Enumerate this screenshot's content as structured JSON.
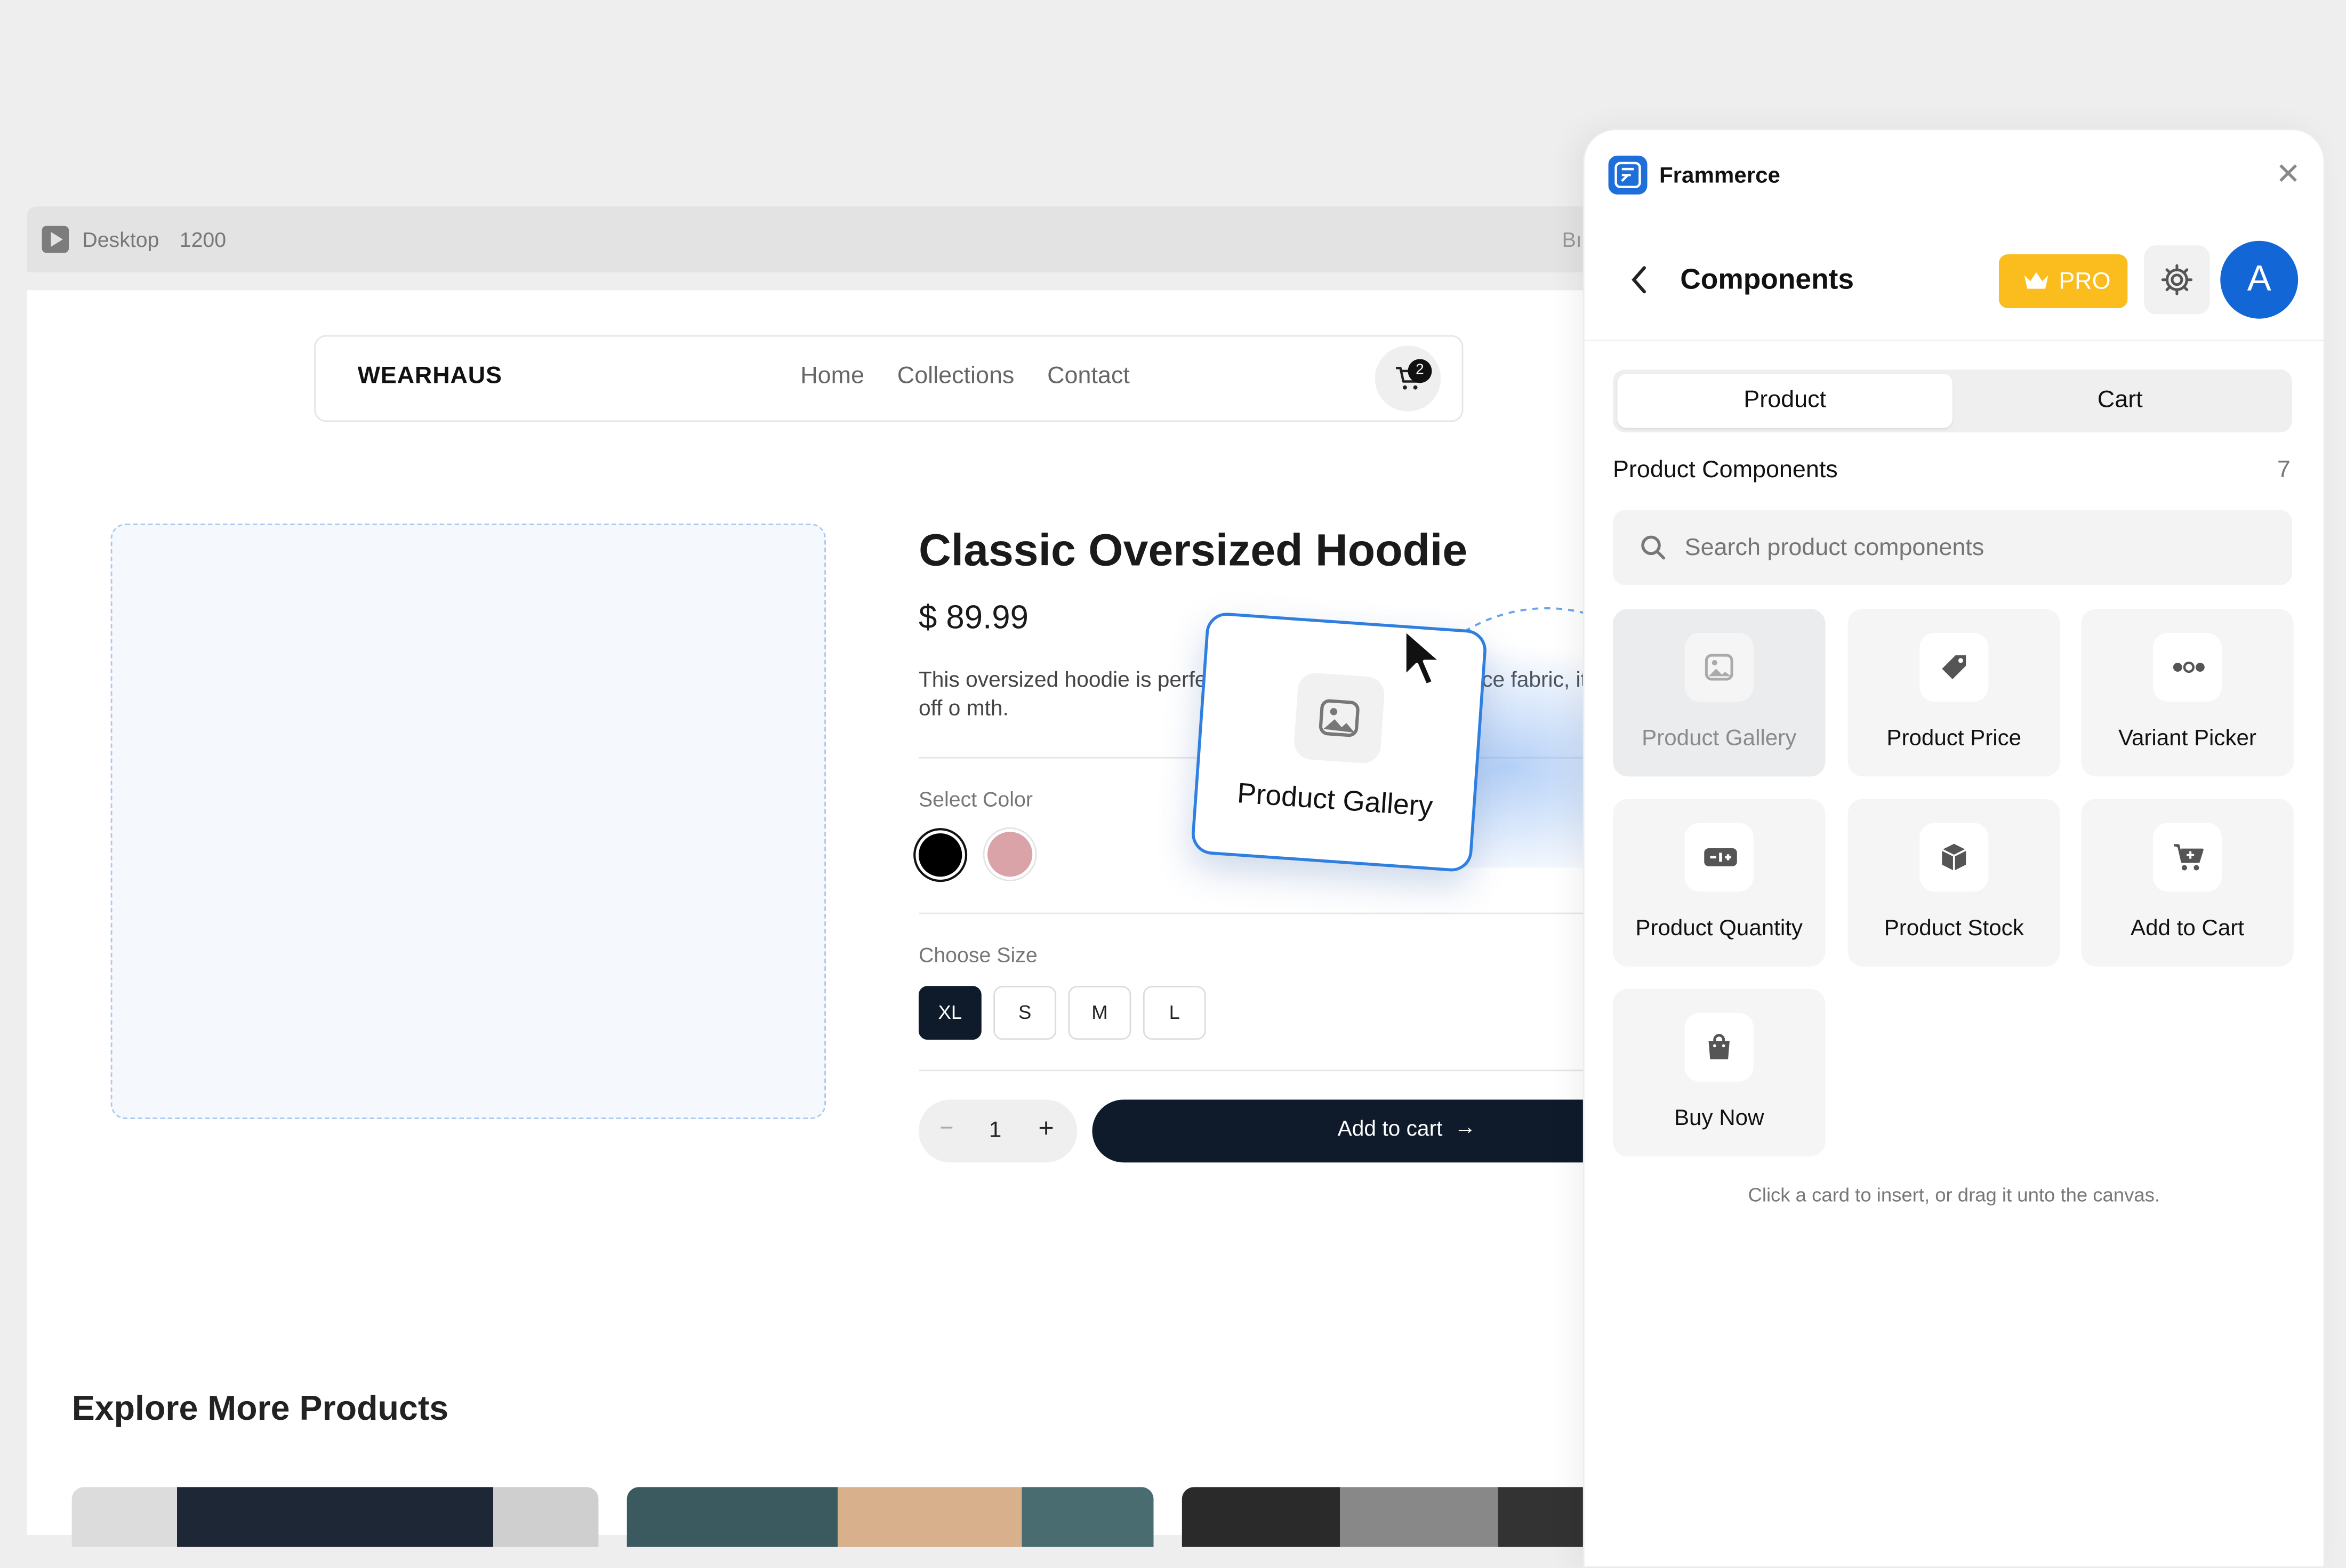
{
  "canvas_bar": {
    "device": "Desktop",
    "width": "1200",
    "edge_text": "Bı"
  },
  "store": {
    "brand": "WEARHAUS",
    "nav": [
      "Home",
      "Collections",
      "Contact"
    ],
    "cart_count": "2"
  },
  "product": {
    "title": "Classic Oversized Hoodie",
    "price": "$ 89.99",
    "description": "This oversized hoodie is perfe                                     ed from a sc breathable fleece fabric, it off                                     o mth.",
    "color_label": "Select Color",
    "colors": [
      "#000000",
      "#d9a3a8"
    ],
    "size_label": "Choose Size",
    "sizes": [
      "XL",
      "S",
      "M",
      "L"
    ],
    "selected_size": "XL",
    "quantity": "1",
    "quantity_minus": "−",
    "quantity_plus": "+",
    "add_to_cart": "Add to cart",
    "add_arrow": "→"
  },
  "explore_title": "Explore More Products",
  "dragging_card": {
    "label": "Product Gallery",
    "icon": "image-icon"
  },
  "panel": {
    "app_name": "Frammerce",
    "close": "✕",
    "title": "Components",
    "pro_label": "PRO",
    "avatar_letter": "A",
    "tabs": [
      "Product",
      "Cart"
    ],
    "active_tab": "Product",
    "section_title": "Product Components",
    "section_count": "7",
    "search_placeholder": "Search product components",
    "cards": [
      {
        "label": "Product Gallery",
        "icon": "image-icon",
        "state": "dragging"
      },
      {
        "label": "Product Price",
        "icon": "price-tag-icon"
      },
      {
        "label": "Variant Picker",
        "icon": "dots-icon"
      },
      {
        "label": "Product Quantity",
        "icon": "quantity-icon"
      },
      {
        "label": "Product Stock",
        "icon": "box-icon"
      },
      {
        "label": "Add to Cart",
        "icon": "cart-icon"
      },
      {
        "label": "Buy Now",
        "icon": "bag-icon"
      }
    ],
    "hint": "Click a card to insert, or drag it unto the canvas."
  },
  "colors": {
    "accent": "#1e6fd9",
    "pro": "#fbbd1d",
    "primary_dark": "#0f1b2b",
    "avatar": "#1366d6"
  }
}
